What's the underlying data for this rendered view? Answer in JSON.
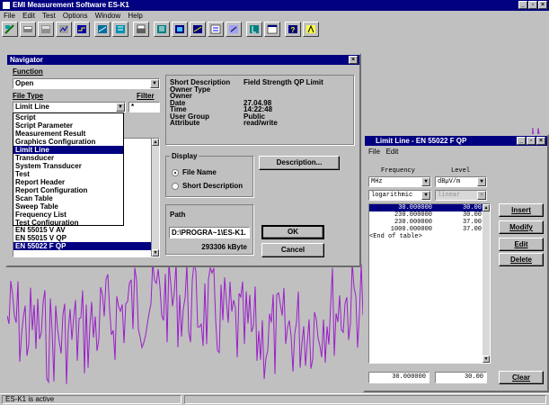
{
  "app": {
    "title": "EMI Measurement Software ES-K1",
    "menu": [
      "File",
      "Edit",
      "Test",
      "Options",
      "Window",
      "Help"
    ],
    "status": "ES-K1 is active"
  },
  "navigator": {
    "title": "Navigator",
    "function_label": "Function",
    "function_value": "Open",
    "filetype_label": "File Type",
    "filetype_value": "Limit Line",
    "filter_label": "Filter",
    "filter_value": "*",
    "filetype_options": [
      "Script",
      "Script Parameter",
      "Measurement Result",
      "Graphics Configuration",
      "Limit Line",
      "Transducer",
      "System Transducer",
      "Test",
      "Report Header",
      "Report Configuration",
      "Scan Table",
      "Sweep Table",
      "Frequency List",
      "Test Configuration"
    ],
    "filetype_selected": "Limit Line",
    "files": [
      "EN 55014 V QP",
      "EN 55015 V AV",
      "EN 55015 V QP",
      "EN 55022 F QP"
    ],
    "file_selected": "EN 55022 F QP",
    "info_labels": [
      "Short Description",
      "Owner Type",
      "Owner",
      "Date",
      "Time",
      "User Group",
      "Attribute"
    ],
    "info_values": [
      "Field Strength QP Limit",
      "",
      "",
      "27.04.98",
      "14:22:48",
      "Public",
      "read/write"
    ],
    "display_label": "Display",
    "display_file_name": "File Name",
    "display_short_desc": "Short Description",
    "description_button": "Description...",
    "path_label": "Path",
    "path_value": "D:\\PROGRA~1\\ES-K1.",
    "free_space": "293306 kByte",
    "ok_button": "OK",
    "cancel_button": "Cancel"
  },
  "limit_line": {
    "title": "Limit Line - EN 55022 F QP",
    "menu": [
      "File",
      "Edit"
    ],
    "frequency_header": "Frequency",
    "level_header": "Level",
    "freq_unit": "MHz",
    "level_unit": "dBµV/m",
    "freq_scale": "logarithmic",
    "level_scale": "linear",
    "rows": [
      {
        "freq": "30.000000",
        "level": "30.00"
      },
      {
        "freq": "230.000000",
        "level": "30.00"
      },
      {
        "freq": "230.000000",
        "level": "37.00"
      },
      {
        "freq": "1000.000000",
        "level": "37.00"
      }
    ],
    "end_text": "<End of table>",
    "edit_freq": "30.000000",
    "edit_level": "30.00",
    "buttons": {
      "insert": "Insert",
      "modify": "Modify",
      "edit": "Edit",
      "delete": "Delete",
      "clear": "Clear"
    }
  },
  "colors": {
    "title": "#000080",
    "trace": "#9a1fc9",
    "plot_bg": "#c8c8c8"
  }
}
